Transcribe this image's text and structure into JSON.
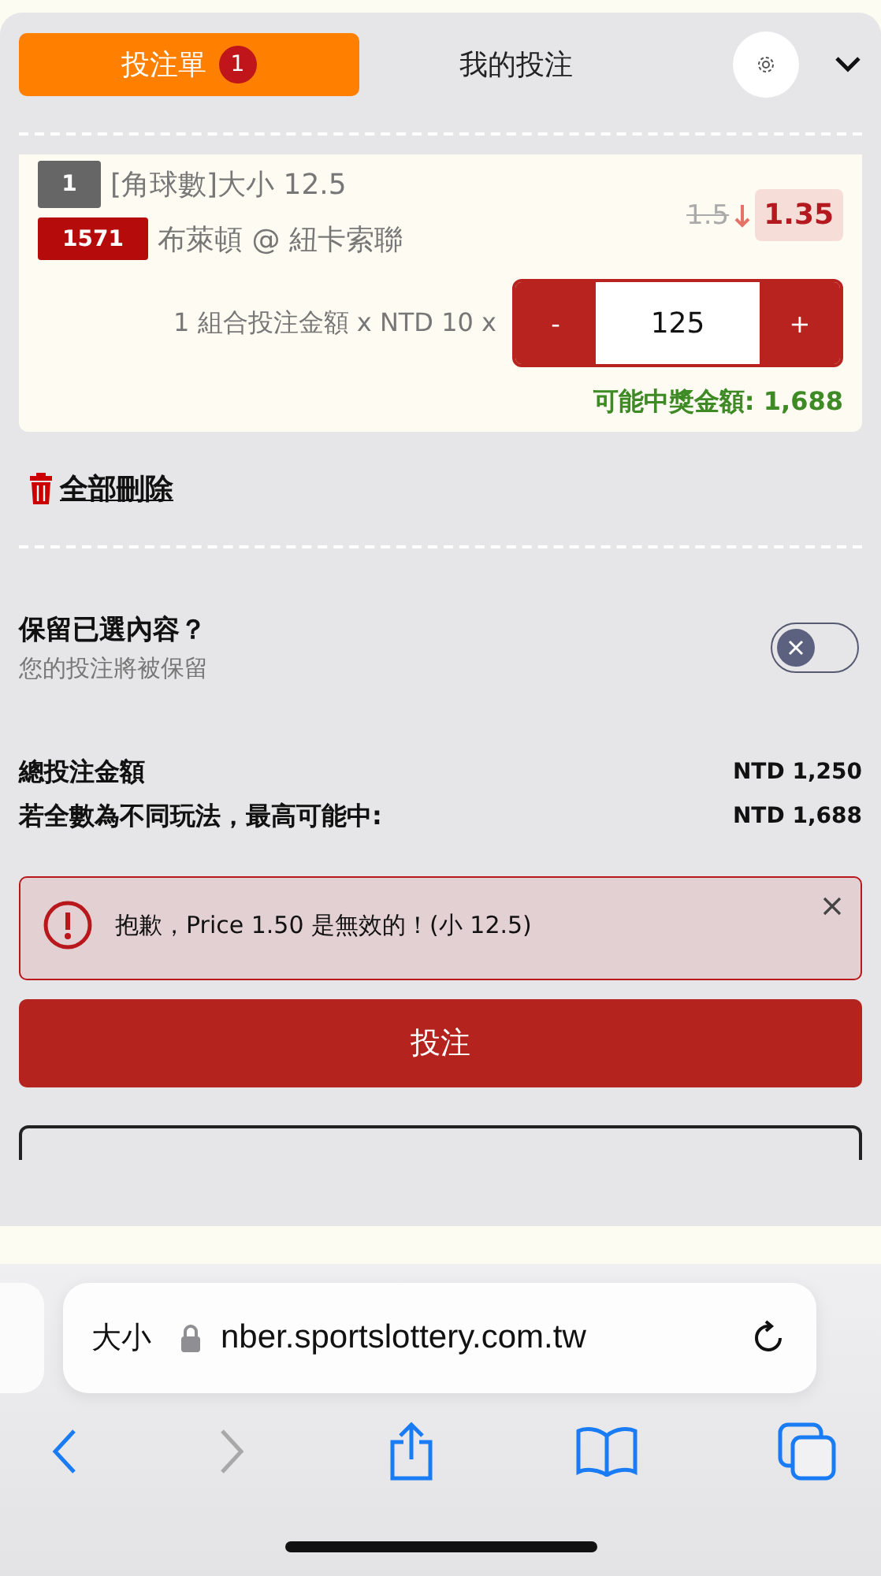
{
  "tabs": [
    {
      "label": "投注單",
      "badge": "1",
      "selected": true
    },
    {
      "label": "我的投注",
      "selected": false
    }
  ],
  "bet": {
    "index": "1",
    "market": "[角球數]大小 12.5",
    "match_code": "1571",
    "match": "布萊頓 @ 紐卡索聯",
    "old_odds": "1.5",
    "odds": "1.35",
    "stake_label": "1 組合投注金額 x NTD 10 x",
    "minus": "-",
    "stake": "125",
    "plus": "+",
    "payout": "可能中獎金額: 1,688"
  },
  "delete_all": "全部刪除",
  "keep": {
    "title": "保留已選內容？",
    "subtitle": "您的投注將被保留",
    "on": false
  },
  "totals": [
    {
      "label": "總投注金額",
      "value": "NTD 1,250"
    },
    {
      "label": "若全數為不同玩法，最高可能中:",
      "value": "NTD 1,688"
    }
  ],
  "error": {
    "message": "抱歉，Price 1.50 是無效的！(小 12.5)"
  },
  "submit": "投注",
  "browser": {
    "text_size": "大小",
    "url": "nber.sportslottery.com.tw",
    "back_disabled": false,
    "forward_disabled": true
  }
}
